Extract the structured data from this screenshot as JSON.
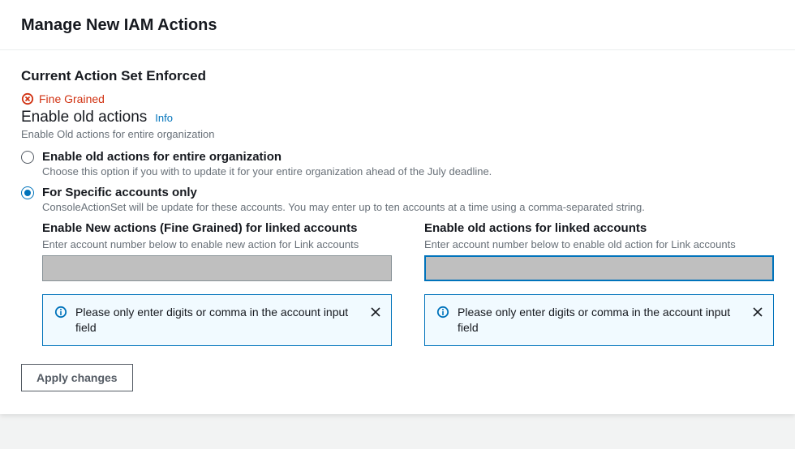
{
  "header": {
    "title": "Manage New IAM Actions"
  },
  "current": {
    "section_title": "Current Action Set Enforced",
    "status_label": "Fine Grained"
  },
  "enable": {
    "heading": "Enable old actions",
    "info_label": "Info",
    "description": "Enable Old actions for entire organization"
  },
  "options": [
    {
      "label": "Enable old actions for entire organization",
      "description": "Choose this option if you with to update it for your entire organization ahead of the July deadline.",
      "selected": false
    },
    {
      "label": "For Specific accounts only",
      "description": "ConsoleActionSet will be update for these accounts. You may enter up to ten accounts at a time using a comma-separated string.",
      "selected": true
    }
  ],
  "columns": {
    "left": {
      "title": "Enable New actions (Fine Grained) for linked accounts",
      "sub": "Enter account number below to enable new action for Link accounts",
      "value": "",
      "alert": "Please only enter digits or comma in the account input field"
    },
    "right": {
      "title": "Enable old actions for linked accounts",
      "sub": "Enter account number below to enable old action for Link accounts",
      "value": "",
      "alert": "Please only enter digits or comma in the account input field"
    }
  },
  "actions": {
    "apply_label": "Apply changes"
  }
}
